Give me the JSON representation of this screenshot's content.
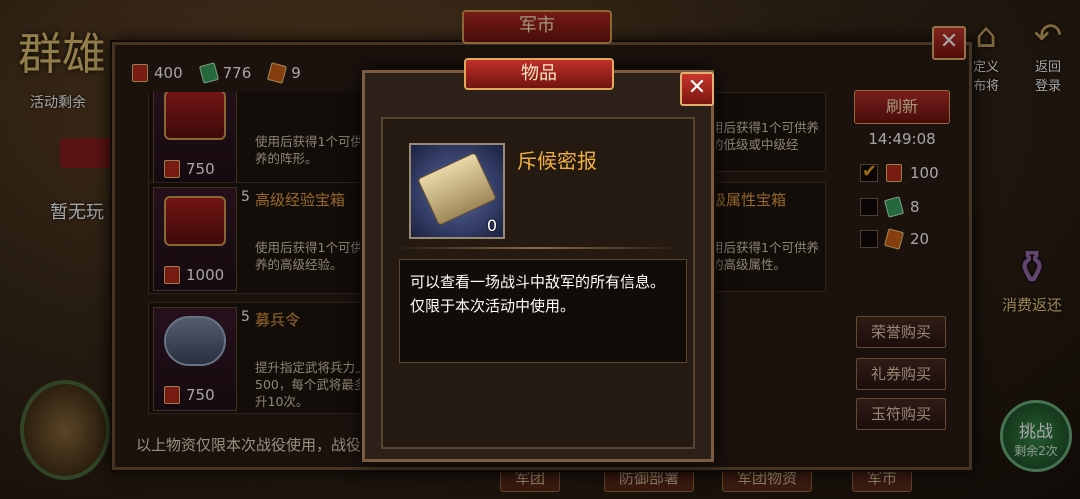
{
  "background": {
    "title": "群雄",
    "activity_text": "活动剩余",
    "no_rank": "暂无玩",
    "right_icons": [
      {
        "label": "定义\n布将",
        "icon": "house-icon"
      },
      {
        "label": "返回\n登录",
        "icon": "back-arrow-icon"
      }
    ],
    "refund_label": "消费返还",
    "challenge": {
      "label": "挑战",
      "sub": "剩余2次"
    },
    "bottom_tabs": [
      "军团",
      "防御部署",
      "军团物资",
      "军市"
    ]
  },
  "panel": {
    "title": "军市",
    "currencies": [
      {
        "icon": "honor-token-icon",
        "value": "400"
      },
      {
        "icon": "coupon-icon",
        "value": "776"
      },
      {
        "icon": "jade-tally-icon",
        "value": "9"
      }
    ],
    "items": [
      {
        "count": "",
        "name": "",
        "desc": "使用后获得1个可供培养的阵形。",
        "price": "750"
      },
      {
        "count": "5",
        "name": "高级经验宝箱",
        "desc": "使用后获得1个可供培养的高级经验。",
        "price": "1000"
      },
      {
        "count": "5",
        "name": "募兵令",
        "desc": "提升指定武将兵力上限500，每个武将最多提升10次。",
        "price": "750"
      },
      {
        "count": "",
        "name": "",
        "desc": "用后获得1个可供养的低级或中级经",
        "price": ""
      },
      {
        "count": "",
        "name": "级属性宝箱",
        "desc": "用后获得1个可供养的高级属性。",
        "price": ""
      }
    ],
    "sidebar": {
      "refresh": "刷新",
      "timer": "14:49:08",
      "filters": [
        {
          "checked": true,
          "icon": "honor-token-icon",
          "value": "100"
        },
        {
          "checked": false,
          "icon": "coupon-icon",
          "value": "8"
        },
        {
          "checked": false,
          "icon": "jade-tally-icon",
          "value": "20"
        }
      ],
      "buy_buttons": [
        "荣誉购买",
        "礼券购买",
        "玉符购买"
      ]
    },
    "footer": "以上物资仅限本次战役使用，战役结束后会自动移除。"
  },
  "modal": {
    "title": "物品",
    "item_name": "斥候密报",
    "item_qty": "0",
    "description": "可以查看一场战斗中敌军的所有信息。仅限于本次活动中使用。"
  }
}
